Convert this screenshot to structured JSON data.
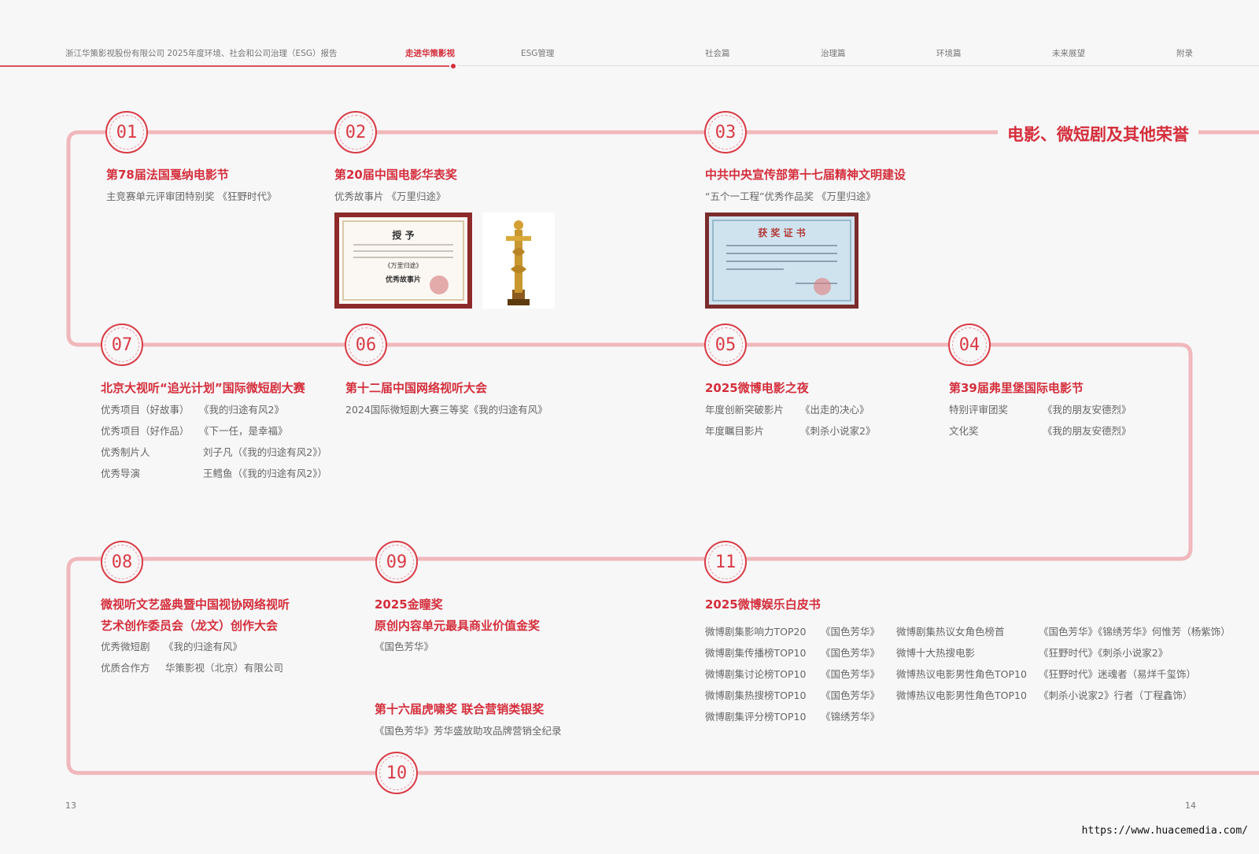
{
  "header": {
    "report_title": "浙江华策影视股份有限公司 2025年度环境、社会和公司治理（ESG）报告",
    "nav": [
      "走进华策影视",
      "ESG管理",
      "社会篇",
      "治理篇",
      "环境篇",
      "未来展望",
      "附录"
    ],
    "active": "走进华策影视"
  },
  "colors": {
    "accent": "#d42e3b",
    "track": "#f0b8bc"
  },
  "section_title": "电影、微短剧及其他荣誉",
  "badges": [
    "01",
    "02",
    "03",
    "04",
    "05",
    "06",
    "07",
    "08",
    "09",
    "10",
    "11"
  ],
  "items": {
    "i01": {
      "title": "第78届法国戛纳电影节",
      "lines": [
        "主竞赛单元评审团特别奖 《狂野时代》"
      ]
    },
    "i02": {
      "title": "第20届中国电影华表奖",
      "lines": [
        "优秀故事片 《万里归途》"
      ]
    },
    "i03": {
      "title": "中共中央宣传部第十七届精神文明建设",
      "lines": [
        "“五个一工程”优秀作品奖 《万里归途》"
      ]
    },
    "i04": {
      "title": "第39届弗里堡国际电影节",
      "rows": [
        [
          "特别评审团奖",
          "《我的朋友安德烈》"
        ],
        [
          "文化奖",
          "《我的朋友安德烈》"
        ]
      ]
    },
    "i05": {
      "title": "2025微博电影之夜",
      "rows": [
        [
          "年度创新突破影片",
          "《出走的决心》"
        ],
        [
          "年度瞩目影片",
          "《刺杀小说家2》"
        ]
      ]
    },
    "i06": {
      "title": "第十二届中国网络视听大会",
      "lines": [
        "2024国际微短剧大赛三等奖《我的归途有风》"
      ]
    },
    "i07": {
      "title": "北京大视听“追光计划”国际微短剧大赛",
      "rows": [
        [
          "优秀项目（好故事）",
          "《我的归途有风2》"
        ],
        [
          "优秀项目（好作品）",
          "《下一任，是幸福》"
        ],
        [
          "优秀制片人",
          "刘子凡（《我的归途有风2》）"
        ],
        [
          "优秀导演",
          "王鳕鱼（《我的归途有风2》）"
        ]
      ]
    },
    "i08": {
      "title_lines": [
        "微视听文艺盛典暨中国视协网络视听",
        "艺术创作委员会（龙文）创作大会"
      ],
      "rows": [
        [
          "优秀微短剧",
          "《我的归途有风》"
        ],
        [
          "优质合作方",
          "华策影视（北京）有限公司"
        ]
      ]
    },
    "i09": {
      "title_lines": [
        "2025金瞳奖",
        "原创内容单元最具商业价值金奖"
      ],
      "lines": [
        "《国色芳华》"
      ]
    },
    "i10": {
      "title": "第十六届虎啸奖 联合营销类银奖",
      "lines": [
        "《国色芳华》芳华盛放助攻品牌营销全纪录"
      ]
    },
    "i11": {
      "title": "2025微博娱乐白皮书",
      "left": [
        [
          "微博剧集影响力TOP20",
          "《国色芳华》"
        ],
        [
          "微博剧集传播榜TOP10",
          "《国色芳华》"
        ],
        [
          "微博剧集讨论榜TOP10",
          "《国色芳华》"
        ],
        [
          "微博剧集热搜榜TOP10",
          "《国色芳华》"
        ],
        [
          "微博剧集评分榜TOP10",
          "《锦绣芳华》"
        ]
      ],
      "right": [
        [
          "微博剧集热议女角色榜首",
          "《国色芳华》《锦绣芳华》何惟芳（杨紫饰）"
        ],
        [
          "微博十大热搜电影",
          "《狂野时代》《刺杀小说家2》"
        ],
        [
          "微博热议电影男性角色TOP10",
          "《狂野时代》迷魂者（易烊千玺饰）"
        ],
        [
          "微博热议电影男性角色TOP10",
          "《刺杀小说家2》行者（丁程鑫饰）"
        ]
      ]
    }
  },
  "certificates": {
    "cert1": {
      "heading": "授 予",
      "film": "《万里归途》",
      "award": "优秀故事片"
    },
    "cert2": {
      "heading": "获 奖 证 书"
    }
  },
  "page_numbers": {
    "left": "13",
    "right": "14"
  },
  "url": "https://www.huacemedia.com/"
}
